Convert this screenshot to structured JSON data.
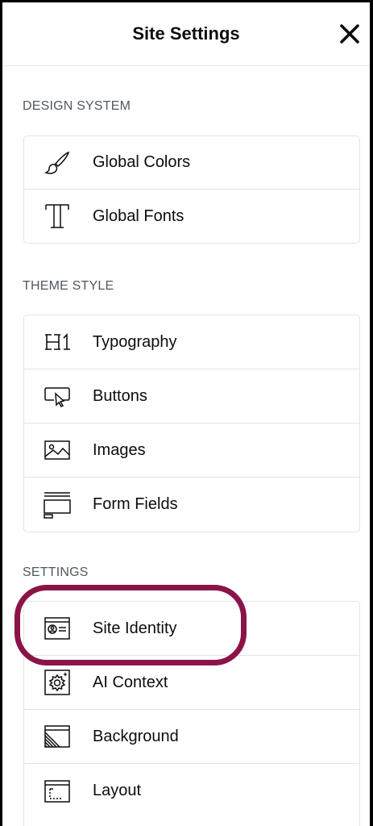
{
  "header": {
    "title": "Site Settings"
  },
  "sections": {
    "design_system": {
      "title": "DESIGN SYSTEM",
      "items": [
        {
          "label": "Global Colors",
          "icon": "brush-icon"
        },
        {
          "label": "Global Fonts",
          "icon": "typography-t-icon"
        }
      ]
    },
    "theme_style": {
      "title": "THEME STYLE",
      "items": [
        {
          "label": "Typography",
          "icon": "heading-h1-icon"
        },
        {
          "label": "Buttons",
          "icon": "button-cursor-icon"
        },
        {
          "label": "Images",
          "icon": "image-icon"
        },
        {
          "label": "Form Fields",
          "icon": "form-fields-icon"
        }
      ]
    },
    "settings": {
      "title": "SETTINGS",
      "items": [
        {
          "label": "Site Identity",
          "icon": "site-identity-icon"
        },
        {
          "label": "AI Context",
          "icon": "ai-gear-icon"
        },
        {
          "label": "Background",
          "icon": "background-icon"
        },
        {
          "label": "Layout",
          "icon": "layout-icon"
        }
      ]
    }
  },
  "highlight_color": "#8a1448"
}
